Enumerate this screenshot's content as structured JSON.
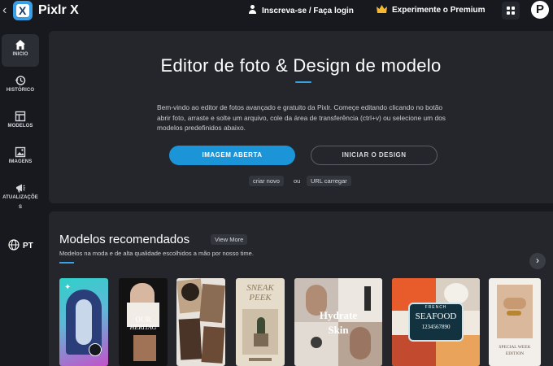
{
  "app": {
    "name": "Pixlr X",
    "logo_letter": "X"
  },
  "header": {
    "signin_label": "Inscreva-se / Faça login",
    "premium_label": "Experimente o Premium",
    "avatar_letter": "P"
  },
  "sidebar": {
    "items": [
      {
        "label": "INICIO",
        "icon": "home-icon"
      },
      {
        "label": "HISTÓRICO",
        "icon": "history-icon"
      },
      {
        "label": "MODELOS",
        "icon": "templates-icon"
      },
      {
        "label": "IMAGENS",
        "icon": "image-icon"
      },
      {
        "label": "ATUALIZAÇÕE",
        "label2": "S",
        "icon": "megaphone-icon"
      }
    ],
    "language": "PT"
  },
  "hero": {
    "title": "Editor de foto & Design de modelo",
    "description": "Bem-vindo ao editor de fotos avançado e gratuito da Pixlr. Começe editando clicando no botão abrir foto, arraste e solte um arquivo, cole da área de transferência (ctrl+v) ou selecione um dos modelos predefinidos abaixo.",
    "open_button": "IMAGEM ABERTA",
    "design_button": "INICIAR O DESIGN",
    "new_link": "criar novo",
    "or_text": "ou",
    "url_link": "URL carregar"
  },
  "templates": {
    "title": "Modelos recomendados",
    "view_more": "View More",
    "subtitle": "Modelos na moda e de alta qualidade escolhidos a mão por nosso time.",
    "cards": [
      {
        "name": "template-fashion-pink"
      },
      {
        "name": "template-our-heritage",
        "text1": "OUR",
        "text2": "HERITAG"
      },
      {
        "name": "template-collage-brown"
      },
      {
        "name": "template-sneak-peek",
        "text1": "SNEAK",
        "text2": "PEEK"
      },
      {
        "name": "template-hydrate-skin",
        "text1": "Hydrate",
        "text2": "Skin"
      },
      {
        "name": "template-seafood",
        "text1": "FRENCH",
        "text2": "SEAFOOD",
        "text3": "1234567890"
      },
      {
        "name": "template-special-week",
        "text1": "SPECIAL WEEK",
        "text2": "EDITION"
      }
    ]
  },
  "colors": {
    "accent": "#1c95d8",
    "background": "#17191e",
    "panel": "#24262c"
  }
}
